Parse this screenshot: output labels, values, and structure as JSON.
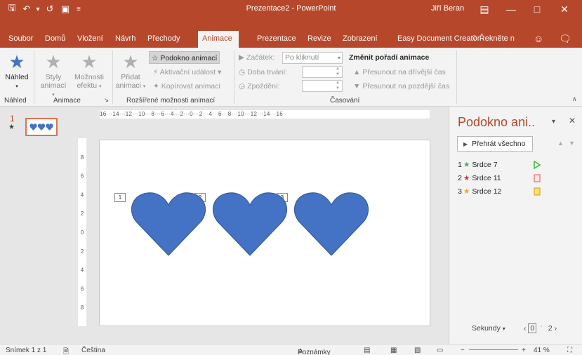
{
  "window": {
    "title": "Prezentace2 - PowerPoint",
    "user": "Jiří Beran",
    "colors": {
      "accent": "#b7472a",
      "heart": "#4472c4",
      "ribbon": "#f3f3f3"
    }
  },
  "tabs": [
    "Soubor",
    "Domů",
    "Vložení",
    "Návrh",
    "Přechody",
    "Animace",
    "Prezentace",
    "Revize",
    "Zobrazení",
    "Easy Document Creator"
  ],
  "active_tab": "Animace",
  "tell_me": "Řekněte n",
  "ribbon": {
    "preview": {
      "label": "Náhled",
      "group": "Náhled"
    },
    "animation_group": {
      "styles_line1": "Styly",
      "styles_line2": "animací",
      "effects_line1": "Možnosti",
      "effects_line2": "efektu",
      "group": "Animace"
    },
    "advanced_group": {
      "add_line1": "Přidat",
      "add_line2": "animaci",
      "pane_button": "Podokno animací",
      "trigger": "Aktivační událost",
      "painter": "Kopírovat animaci",
      "group": "Rozšířené možnosti animací"
    },
    "timing_group": {
      "start_label": "Začátek:",
      "start_value": "Po kliknutí",
      "duration_label": "Doba trvání:",
      "delay_label": "Zpoždění:",
      "reorder_title": "Změnit pořadí animace",
      "move_earlier": "Přesunout na dřívější čas",
      "move_later": "Přesunout na pozdější čas",
      "group": "Časování"
    }
  },
  "thumbnail": {
    "number": "1",
    "star": "★"
  },
  "ruler": {
    "horizontal": "16···14···12···10···8···6···4···2···0···2···4···6···8···10···12···14···16",
    "vertical": [
      "8",
      "6",
      "4",
      "2",
      "0",
      "2",
      "4",
      "6",
      "8"
    ]
  },
  "slide": {
    "tags": [
      "1",
      "2",
      "3"
    ]
  },
  "pane": {
    "title": "Podokno ani..",
    "play_all": "Přehrát všechno",
    "items": [
      {
        "index": "1",
        "name": "Srdce 7",
        "star_color": "#4ca86a",
        "marker": "triangle",
        "marker_color": "#3db83d"
      },
      {
        "index": "2",
        "name": "Srdce 11",
        "star_color": "#c0392b",
        "marker": "square",
        "marker_color": "#f4a3a3"
      },
      {
        "index": "3",
        "name": "Srdce 12",
        "star_color": "#e8a33a",
        "marker": "square",
        "marker_color": "#ffe066"
      }
    ],
    "seconds_label": "Sekundy",
    "timeline_start": "0",
    "timeline_end": "2"
  },
  "status": {
    "slide": "Snímek 1 z 1",
    "language": "Čeština",
    "notes": "Poznámky",
    "zoom": "41 %"
  }
}
